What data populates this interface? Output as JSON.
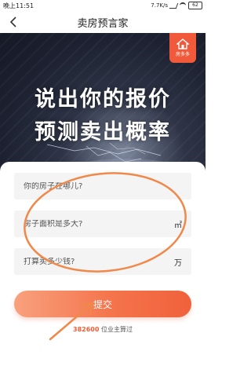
{
  "status_bar": {
    "time": "晚上11:51",
    "network_speed": "7.7K/s",
    "battery": "62"
  },
  "header": {
    "title": "卖房预言家"
  },
  "banner": {
    "brand": "房多多",
    "headline_line1": "说出你的报价",
    "headline_line2": "预测卖出概率"
  },
  "form": {
    "location_placeholder": "你的房子在哪儿?",
    "area_placeholder": "房子面积是多大?",
    "area_unit": "㎡",
    "price_placeholder": "打算卖多少钱?",
    "price_unit": "万",
    "submit_label": "提交"
  },
  "stats": {
    "count": "382600",
    "count_suffix": " 位业主算过"
  },
  "colors": {
    "accent": "#f0613b",
    "annotation": "#f0884a"
  }
}
